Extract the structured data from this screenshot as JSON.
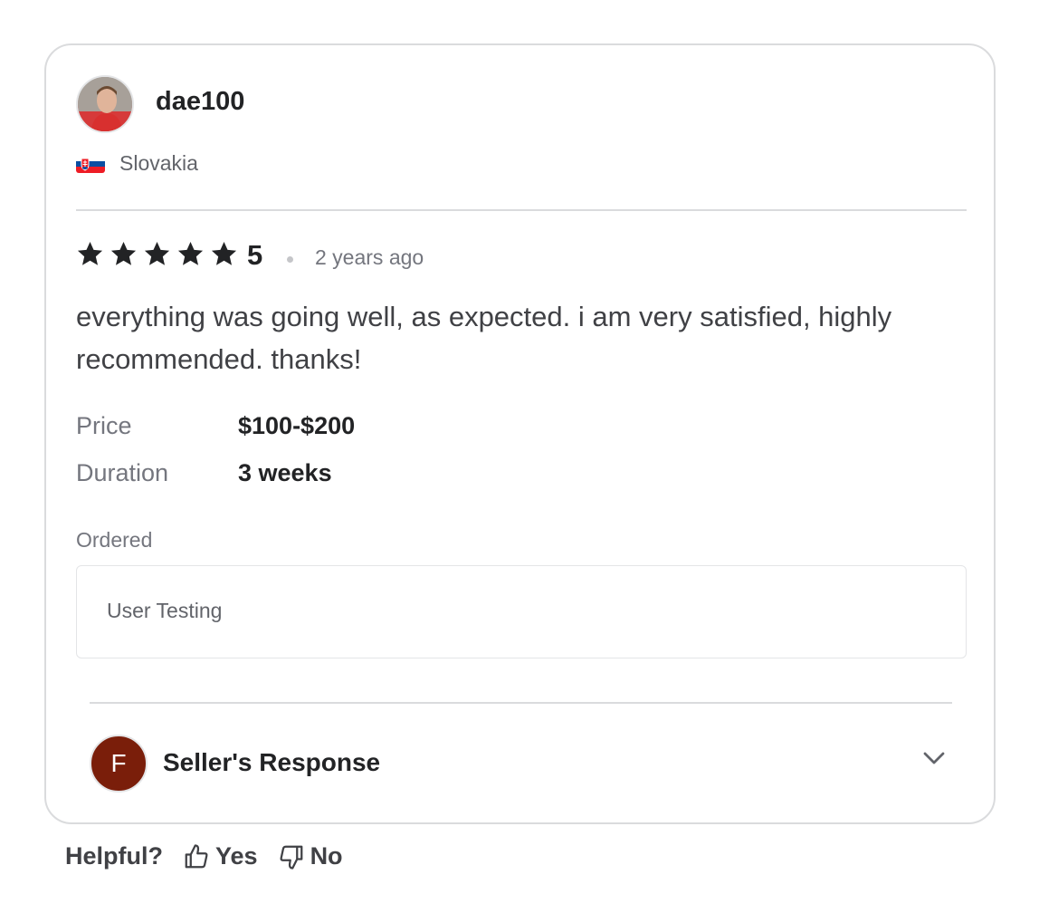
{
  "review": {
    "username": "dae100",
    "country": "Slovakia",
    "rating": "5",
    "rating_stars": 5,
    "time_ago": "2 years ago",
    "text": "everything was going well, as expected. i am very satisfied, highly recommended. thanks!",
    "price_label": "Price",
    "price_value": "$100-$200",
    "duration_label": "Duration",
    "duration_value": "3 weeks",
    "ordered_label": "Ordered",
    "ordered_item": "User Testing"
  },
  "seller_response": {
    "avatar_letter": "F",
    "title": "Seller's Response",
    "avatar_color": "#7a1e0a"
  },
  "helpful": {
    "label": "Helpful?",
    "yes": "Yes",
    "no": "No"
  },
  "icons": {
    "star": "star-icon",
    "chevron": "chevron-down-icon",
    "thumb_up": "thumbs-up-icon",
    "thumb_down": "thumbs-down-icon"
  }
}
